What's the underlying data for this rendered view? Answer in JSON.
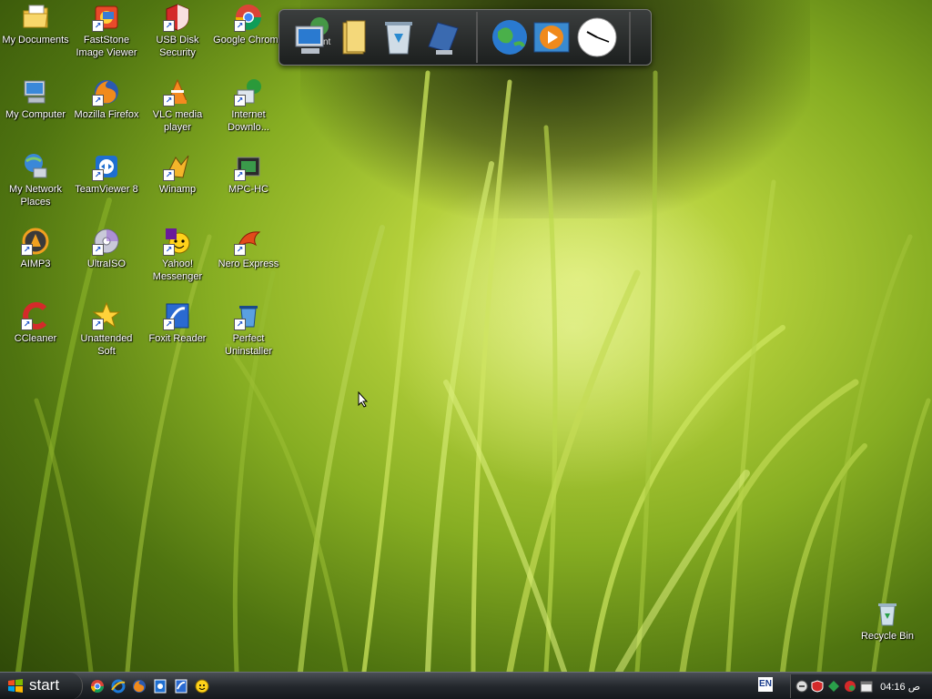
{
  "desktop_icons": [
    {
      "label": "My Documents",
      "icon": "my-documents-icon"
    },
    {
      "label": "FastStone Image Viewer",
      "icon": "faststone-icon"
    },
    {
      "label": "USB Disk Security",
      "icon": "usb-disk-security-icon"
    },
    {
      "label": "Google Chrome",
      "icon": "chrome-icon"
    },
    {
      "label": "My Computer",
      "icon": "my-computer-icon"
    },
    {
      "label": "Mozilla Firefox",
      "icon": "firefox-icon"
    },
    {
      "label": "VLC media player",
      "icon": "vlc-icon"
    },
    {
      "label": "Internet Downlo...",
      "icon": "internet-download-manager-icon"
    },
    {
      "label": "My Network Places",
      "icon": "network-places-icon"
    },
    {
      "label": "TeamViewer 8",
      "icon": "teamviewer-icon"
    },
    {
      "label": "Winamp",
      "icon": "winamp-icon"
    },
    {
      "label": "MPC-HC",
      "icon": "mpc-hc-icon"
    },
    {
      "label": "AIMP3",
      "icon": "aimp3-icon"
    },
    {
      "label": "UltraISO",
      "icon": "ultraiso-icon"
    },
    {
      "label": "Yahoo! Messenger",
      "icon": "yahoo-messenger-icon"
    },
    {
      "label": "Nero Express",
      "icon": "nero-express-icon"
    },
    {
      "label": "CCleaner",
      "icon": "ccleaner-icon"
    },
    {
      "label": "Unattended Soft",
      "icon": "unattended-soft-icon"
    },
    {
      "label": "Foxit Reader",
      "icon": "foxit-reader-icon"
    },
    {
      "label": "Perfect Uninstaller",
      "icon": "perfect-uninstaller-icon"
    }
  ],
  "recycle_bin": {
    "label": "Recycle Bin",
    "icon": "recycle-bin-icon"
  },
  "dock": {
    "items": [
      "computer-icon",
      "folder-icon",
      "trash-icon",
      "control-panel-icon",
      "globe-icon",
      "media-player-icon",
      "clock-icon"
    ],
    "partial_label": "nt"
  },
  "taskbar": {
    "start_label": "start",
    "quick_launch": [
      "chrome-icon",
      "internet-explorer-icon",
      "firefox-icon",
      "teamviewer-icon",
      "foxit-icon",
      "yahoo-messenger-icon"
    ],
    "language": "EN",
    "tray_icons": [
      "yahoo-tray-icon",
      "usb-security-tray-icon",
      "network-tray-icon",
      "antivirus-tray-icon",
      "calendar-tray-icon"
    ],
    "clock": "04:16 ص"
  }
}
